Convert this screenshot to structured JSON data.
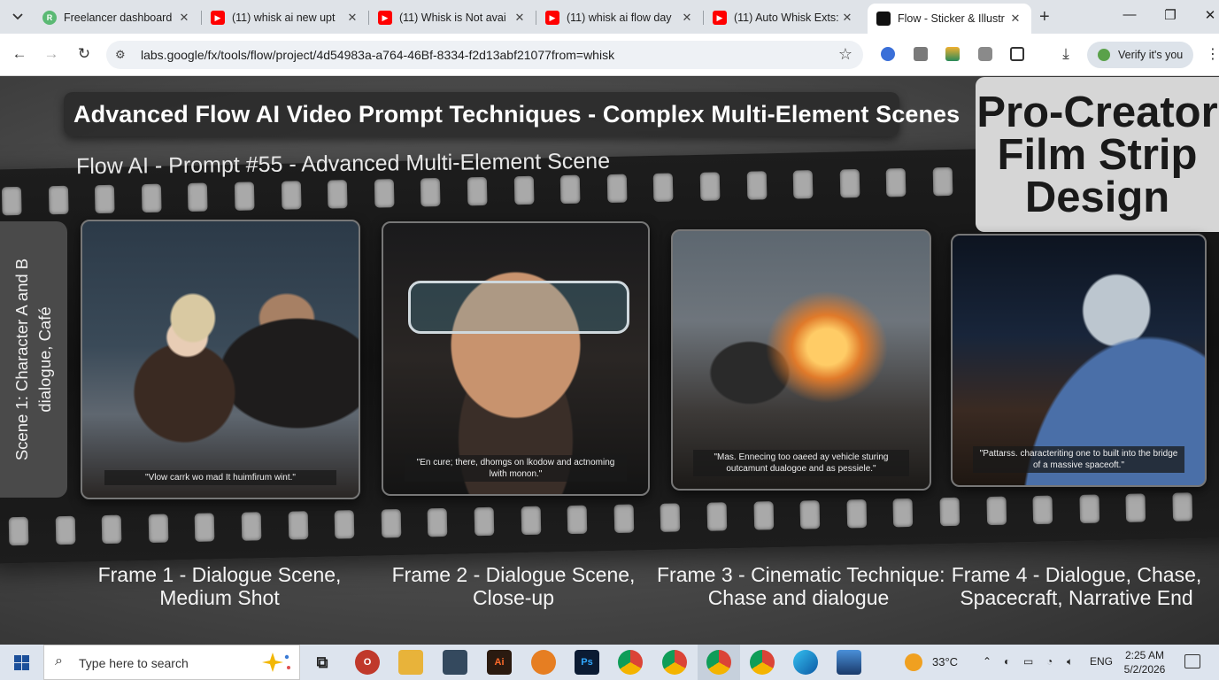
{
  "browser": {
    "tabs": [
      {
        "title": "Freelancer dashboard",
        "icon": "freelancer-icon",
        "color": "#5bb974"
      },
      {
        "title": "(11) whisk ai new upt",
        "icon": "youtube-icon",
        "color": "#ff0000"
      },
      {
        "title": "(11) Whisk is Not avai",
        "icon": "youtube-icon",
        "color": "#ff0000"
      },
      {
        "title": "(11) whisk ai flow day",
        "icon": "youtube-icon",
        "color": "#ff0000"
      },
      {
        "title": "(11) Auto Whisk Exts:",
        "icon": "youtube-icon",
        "color": "#ff0000"
      },
      {
        "title": "Flow - Sticker & Illustr",
        "icon": "flow-icon",
        "color": "#111111",
        "active": true
      }
    ],
    "url": "labs.google/fx/tools/flow/project/4d54983a-a764-46Bf-8334-f2d13abf21077from=whisk",
    "verify_label": "Verify it's you"
  },
  "content": {
    "banner_title": "Advanced Flow AI Video Prompt Techniques - Complex Multi-Element Scenes",
    "strip_subtitle": "Flow AI - Prompt #55 - Advanced Multi-Element Scene",
    "pro_creator": [
      "Pro-Creator",
      "Film Strip",
      "Design"
    ],
    "scene_label_line1": "Scene 1: Character A and B",
    "scene_label_line2": "dialogue, Café",
    "frames": [
      {
        "caption": "\"Vlow carrk wo mad It huimfirum wint.\"",
        "label_line1": "Frame 1 - Dialogue Scene,",
        "label_line2": "Medium Shot"
      },
      {
        "caption": "\"En cure; there, dhomgs on lkodow and actnoming lwith monon.\"",
        "label_line1": "Frame 2 - Dialogue Scene,",
        "label_line2": "Close-up"
      },
      {
        "caption": "\"Mas. Ennecing too oaeed ay vehicle sturing outcamunt dualogoe and as pessiele.\"",
        "label_line1": "Frame 3 - Cinematic Technique:",
        "label_line2": "Chase and dialogue"
      },
      {
        "caption": "\"Pattarss. characteriting one to built into the bridge of a massive spaceoft.\"",
        "label_line1": "Frame 4 - Dialogue, Chase,",
        "label_line2": "Spacecraft, Narrative End"
      }
    ]
  },
  "taskbar": {
    "search_placeholder": "Type here to search",
    "temperature": "33°C",
    "language": "ENG",
    "time": "2:25 AM",
    "date": "5/2/2026"
  }
}
